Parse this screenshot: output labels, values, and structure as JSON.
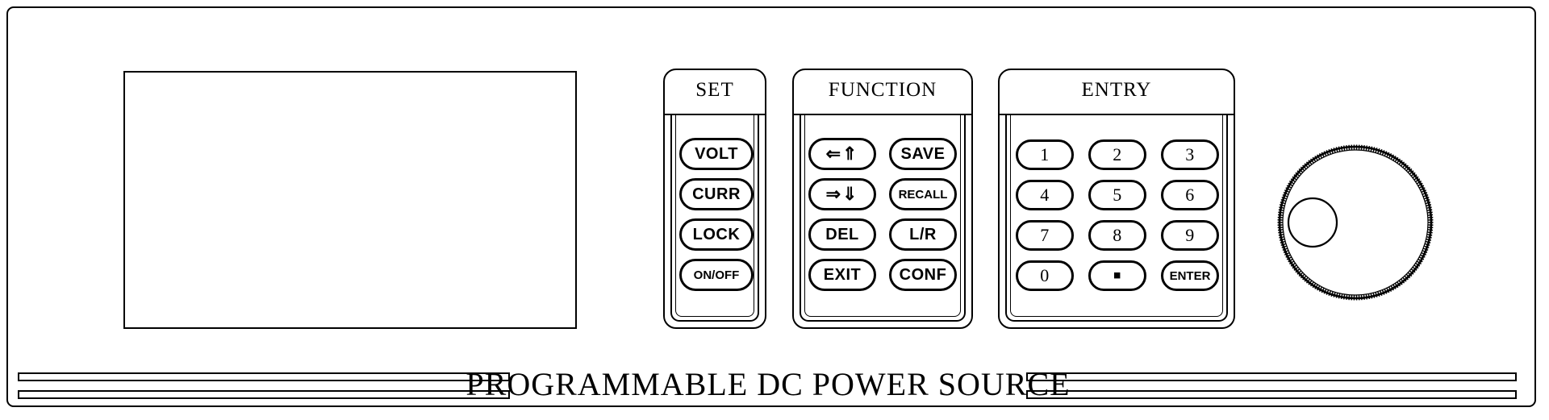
{
  "device": {
    "brand_text": "PROGRAMMABLE  DC  POWER  SOURCE"
  },
  "display": {
    "name": "lcd-display",
    "content": ""
  },
  "groups": [
    {
      "id": "set",
      "title": "SET",
      "keys": [
        {
          "label": "VOLT",
          "name": "volt"
        },
        {
          "label": "CURR",
          "name": "curr"
        },
        {
          "label": "LOCK",
          "name": "lock"
        },
        {
          "label": "ON/OFF",
          "name": "on-off"
        }
      ]
    },
    {
      "id": "function",
      "title": "FUNCTION",
      "keys": [
        {
          "label": "⇐⇑",
          "name": "left-up-arrow"
        },
        {
          "label": "SAVE",
          "name": "save"
        },
        {
          "label": "⇒⇓",
          "name": "right-down-arrow"
        },
        {
          "label": "RECALL",
          "name": "recall"
        },
        {
          "label": "DEL",
          "name": "del"
        },
        {
          "label": "L/R",
          "name": "local-remote"
        },
        {
          "label": "EXIT",
          "name": "exit"
        },
        {
          "label": "CONF",
          "name": "conf"
        }
      ]
    },
    {
      "id": "entry",
      "title": "ENTRY",
      "keys": [
        {
          "label": "1",
          "name": "digit-1"
        },
        {
          "label": "2",
          "name": "digit-2"
        },
        {
          "label": "3",
          "name": "digit-3"
        },
        {
          "label": "4",
          "name": "digit-4"
        },
        {
          "label": "5",
          "name": "digit-5"
        },
        {
          "label": "6",
          "name": "digit-6"
        },
        {
          "label": "7",
          "name": "digit-7"
        },
        {
          "label": "8",
          "name": "digit-8"
        },
        {
          "label": "9",
          "name": "digit-9"
        },
        {
          "label": "0",
          "name": "digit-0"
        },
        {
          "label": "▪",
          "name": "decimal-point"
        },
        {
          "label": "ENTER",
          "name": "enter"
        }
      ]
    }
  ],
  "knob": {
    "name": "rotary-encoder-knob",
    "label": ""
  },
  "colors": {
    "line": "#000000",
    "panel": "#ffffff"
  }
}
